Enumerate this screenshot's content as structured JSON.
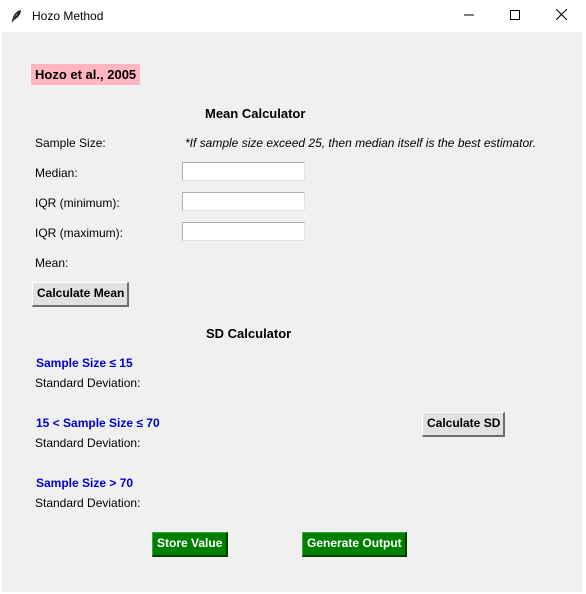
{
  "window": {
    "title": "Hozo Method"
  },
  "reference_label": "Hozo et al., 2005",
  "mean_calculator": {
    "heading": "Mean Calculator",
    "sample_size_label": "Sample Size:",
    "note": "*If sample size exceed 25, then median itself is the best estimator.",
    "median_label": "Median:",
    "median_value": "",
    "iqr_min_label": "IQR (minimum):",
    "iqr_min_value": "",
    "iqr_max_label": "IQR (maximum):",
    "iqr_max_value": "",
    "mean_label": "Mean:",
    "calculate_button": "Calculate Mean"
  },
  "sd_calculator": {
    "heading": "SD Calculator",
    "groups": [
      {
        "label": "Sample Size ≤ 15",
        "sd_label": "Standard Deviation:"
      },
      {
        "label": "15 < Sample Size ≤ 70",
        "sd_label": "Standard Deviation:"
      },
      {
        "label": "Sample Size > 70",
        "sd_label": "Standard Deviation:"
      }
    ],
    "calculate_button": "Calculate SD"
  },
  "actions": {
    "store_button": "Store Value",
    "generate_button": "Generate Output"
  },
  "colors": {
    "reference_bg": "#ffb6c1",
    "group_label": "#0000cc",
    "action_button_bg": "#008000",
    "background": "#f0f0f0"
  },
  "icons": {
    "app": "feather-icon",
    "minimize": "minimize-icon",
    "maximize": "maximize-icon",
    "close": "close-icon"
  }
}
